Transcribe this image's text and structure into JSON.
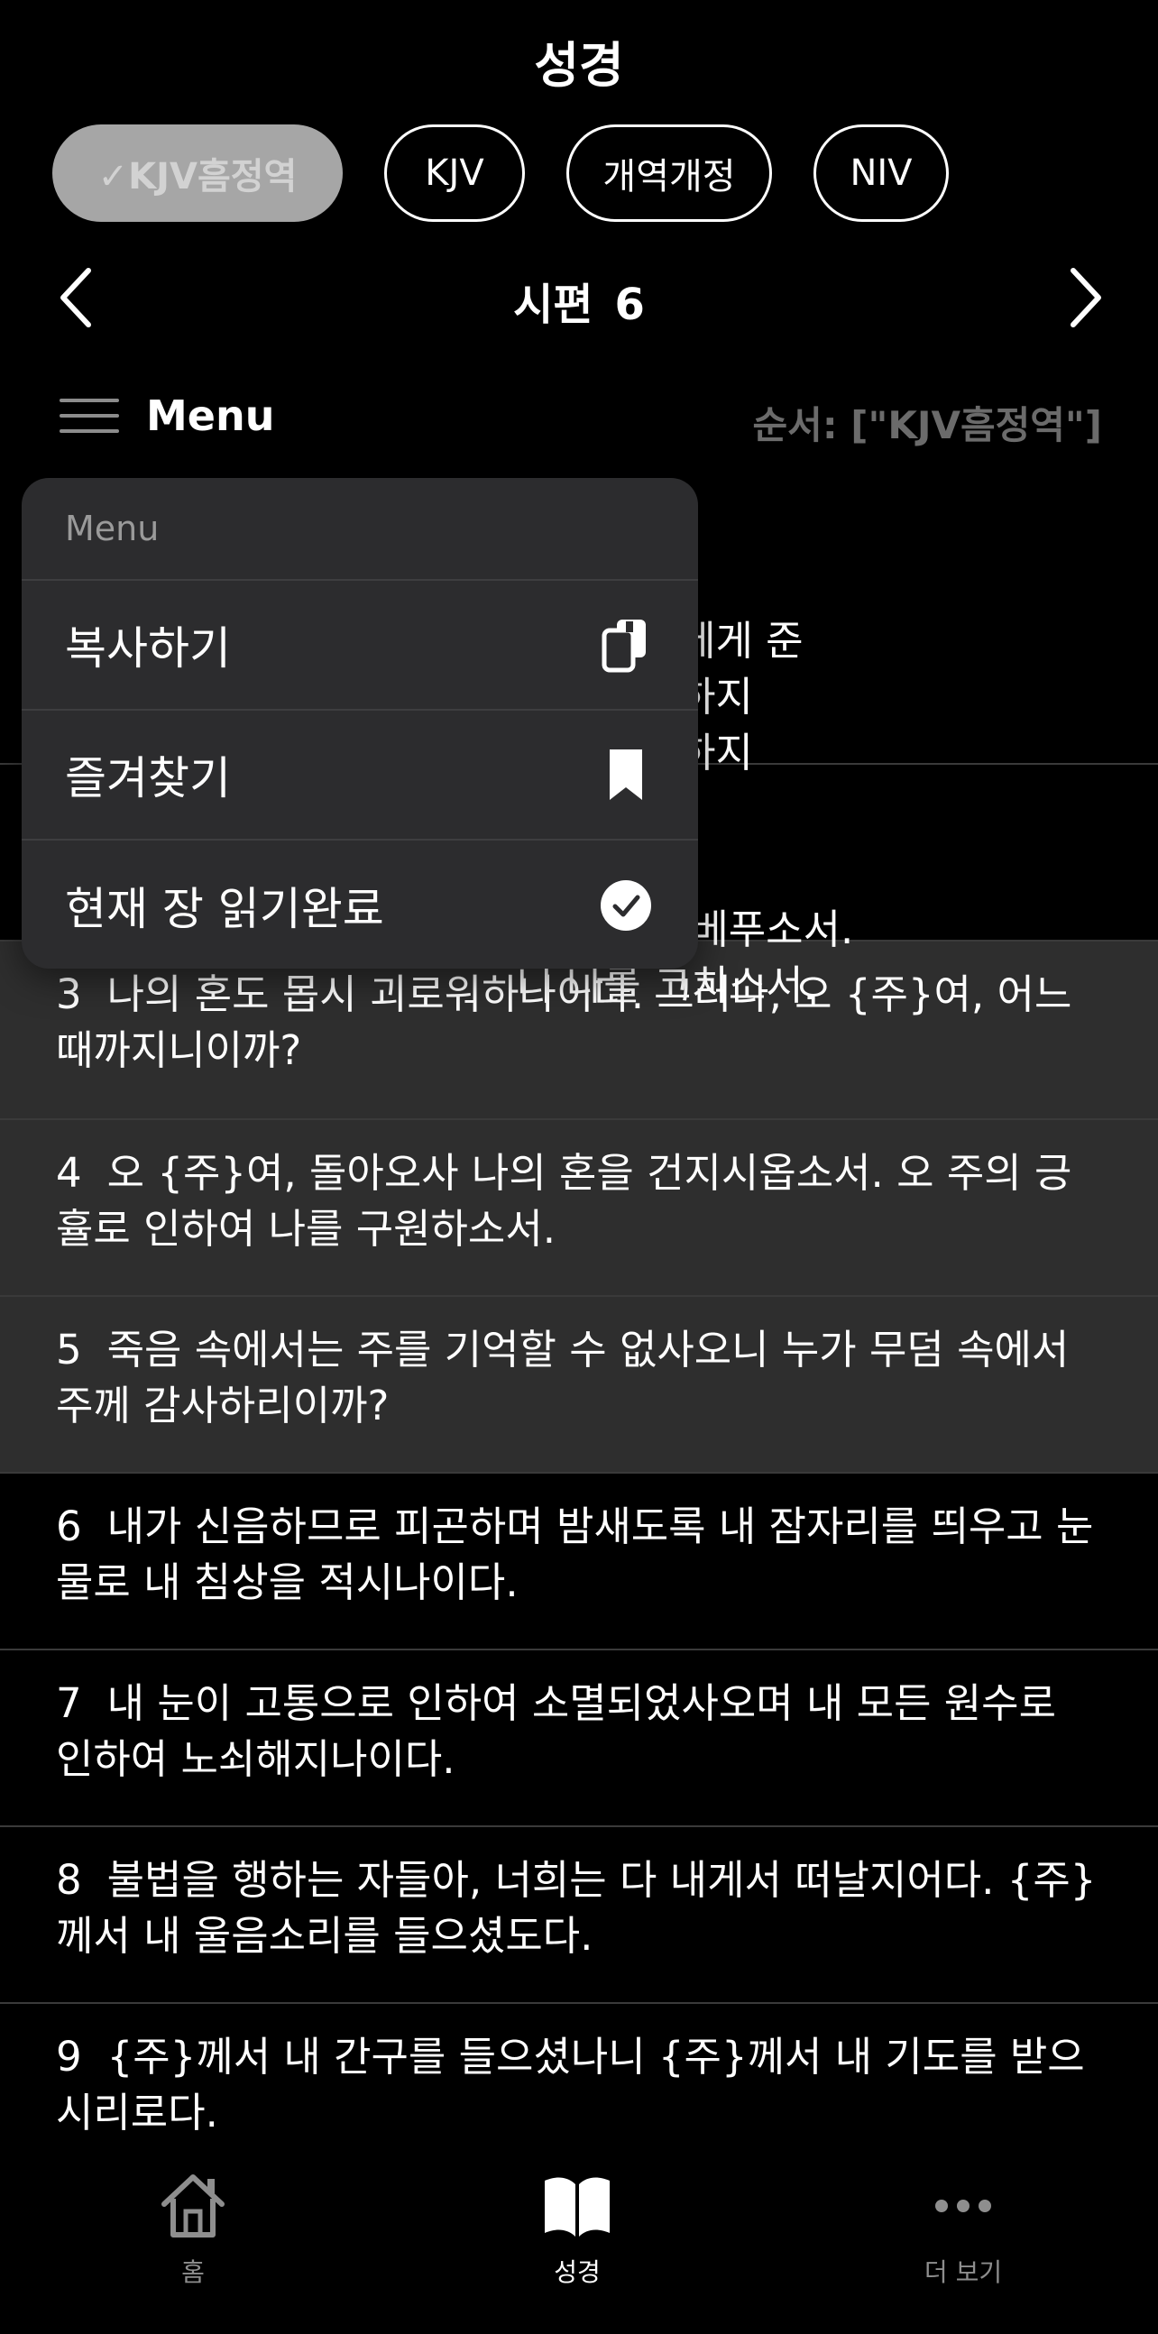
{
  "header": {
    "title": "성경"
  },
  "versions": [
    {
      "label": "✓KJV흠정역",
      "selected": true
    },
    {
      "label": "KJV",
      "selected": false
    },
    {
      "label": "개역개정",
      "selected": false
    },
    {
      "label": "NIV",
      "selected": false
    }
  ],
  "chapter": {
    "book": "시편",
    "number": "6"
  },
  "toolbar": {
    "menu_label": "Menu",
    "order_label": "순서: [\"KJV흠정역\"]"
  },
  "verses": [
    {
      "num": "",
      "lines": "                                        추어 악장에게 준\n                                        나를 책망하지\n                                        나를 징계하지\n "
    },
    {
      "num": "",
      "lines": "                                        께 긍휼을 베푸소서.\n                                        니 나를 고치소서."
    },
    {
      "num": "3",
      "text": "나의 혼도 몹시 괴로워하나이다. 그러나, 오 {주}여, 어느 때까지니이까?"
    },
    {
      "num": "4",
      "text": "오 {주}여, 돌아오사 나의 혼을 건지시옵소서. 오 주의 긍휼로 인하여 나를 구원하소서."
    },
    {
      "num": "5",
      "text": "죽음 속에서는 주를 기억할 수 없사오니 누가 무덤 속에서 주께 감사하리이까?"
    },
    {
      "num": "6",
      "text": "내가 신음하므로 피곤하며 밤새도록 내 잠자리를 띄우고 눈물로 내 침상을 적시나이다."
    },
    {
      "num": "7",
      "text": "내 눈이 고통으로 인하여 소멸되었사오며 내 모든 원수로 인하여 노쇠해지나이다."
    },
    {
      "num": "8",
      "text": "불법을 행하는 자들아, 너희는 다 내게서 떠날지어다. {주}께서 내 울음소리를 들으셨도다."
    },
    {
      "num": "9",
      "text": "{주}께서 내 간구를 들으셨나니 {주}께서 내 기도를 받으시리로다."
    }
  ],
  "popup": {
    "header": "Menu",
    "items": [
      {
        "label": "복사하기",
        "icon": "copy-icon"
      },
      {
        "label": "즐겨찾기",
        "icon": "bookmark-icon"
      },
      {
        "label": "현재 장 읽기완료",
        "icon": "checkmark-circle-icon"
      }
    ]
  },
  "tabbar": {
    "home": "홈",
    "bible": "성경",
    "more": "더 보기"
  }
}
